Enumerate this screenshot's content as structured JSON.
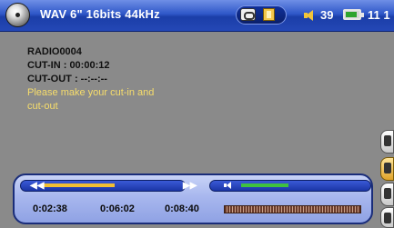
{
  "header": {
    "title": "WAV 6\" 16bits 44kHz",
    "volume": "39",
    "clock": "11 1"
  },
  "info": {
    "name": "RADIO0004",
    "cut_in": "CUT-IN : 00:00:12",
    "cut_out": "CUT-OUT : --:--:--",
    "message": "Please make your cut-in and cut-out"
  },
  "player": {
    "time_a": "0:02:38",
    "time_b": "0:06:02",
    "time_c": "0:08:40",
    "progress_fraction": 0.45,
    "volume_fraction": 0.3
  },
  "icons": {
    "app": "speaker-disc-icon",
    "repeat": "repeat-icon",
    "folder": "folder-icon",
    "speaker": "speaker-icon",
    "battery": "battery-icon"
  },
  "colors": {
    "accent": "#2f57c8",
    "message": "#f7dd6b",
    "progress": "#f2bf32",
    "volume": "#3fc13f"
  }
}
